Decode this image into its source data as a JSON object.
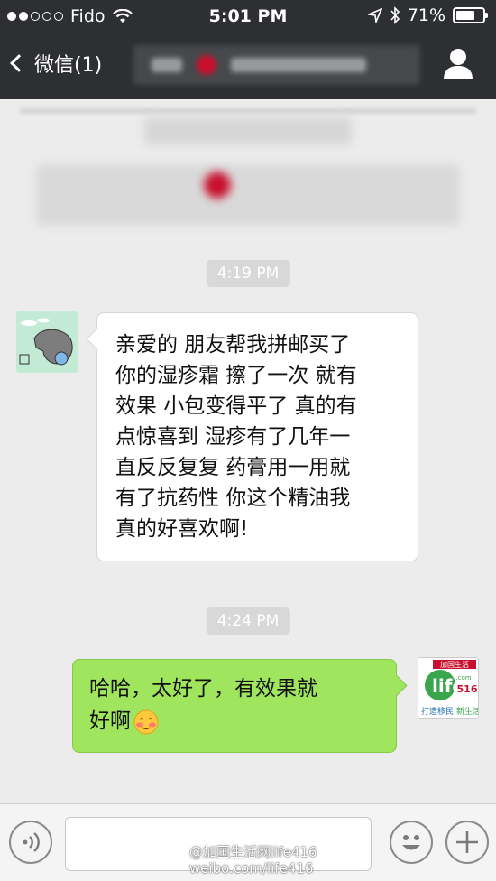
{
  "status_bar": {
    "carrier": "Fido",
    "time": "5:01 PM",
    "battery": "71%",
    "battery_level": 0.71,
    "signal_bars_filled": 2,
    "signal_bars_total": 5
  },
  "nav": {
    "back_label": "微信(1)",
    "back_icon": "chevron-left-icon",
    "profile_icon": "person-icon"
  },
  "messages": [
    {
      "time": "4:19 PM",
      "side": "in",
      "text_lines": [
        "亲爱的 朋友帮我拼邮买了",
        "你的湿疹霜 擦了一次 就有",
        "效果 小包变得平了 真的有",
        "点惊喜到 湿疹有了几年一",
        "直反反复复 药膏用一用就",
        "有了抗药性 你这个精油我",
        "真的好喜欢啊!"
      ]
    },
    {
      "time": "4:24 PM",
      "side": "out",
      "text_lines": [
        "哈哈，太好了，有效果就",
        "好啊"
      ],
      "emoji": "shy-face-emoji"
    }
  ],
  "sender_avatar_text": {
    "line1": "加国生活",
    "line2": ".com",
    "line3": "516",
    "line4": "打造移民",
    "line5": "新生活"
  },
  "input_bar": {
    "voice_icon": "voice-icon",
    "emoji_icon": "smiley-icon",
    "plus_icon": "plus-icon"
  },
  "watermark": {
    "line1": "@加国生活网life416",
    "line2": "weibo.com/life416"
  },
  "colors": {
    "nav_bg": "#2d2f33",
    "chat_bg": "#ececec",
    "outgoing_bubble": "#9fe55e",
    "incoming_bubble": "#ffffff"
  }
}
